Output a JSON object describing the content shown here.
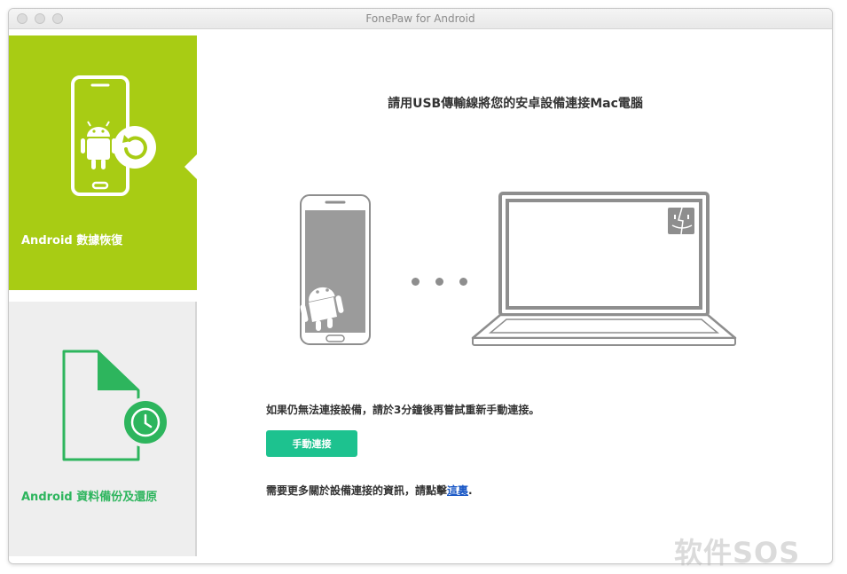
{
  "window": {
    "title": "FonePaw for Android"
  },
  "sidebar": {
    "items": [
      {
        "label": "Android 數據恢復",
        "icon": "android-phone-restore-icon",
        "active": true
      },
      {
        "label": "Android 資料備份及還原",
        "icon": "file-backup-clock-icon",
        "active": false
      }
    ]
  },
  "main": {
    "headline": "請用USB傳輸線將您的安卓設備連接Mac電腦",
    "hint": "如果仍無法連接設備，請於3分鐘後再嘗試重新手動連接。",
    "button_label": "手動連接",
    "info_prefix": "需要更多關於設備連接的資訊，請點擊",
    "info_link": "這裏",
    "info_suffix": "."
  },
  "watermark": "软件SOS",
  "colors": {
    "active_panel": "#a8cc14",
    "backup_green": "#2db55d",
    "button": "#1dc28f",
    "link": "#1a58c6",
    "illustration_gray": "#8e8e8e"
  }
}
